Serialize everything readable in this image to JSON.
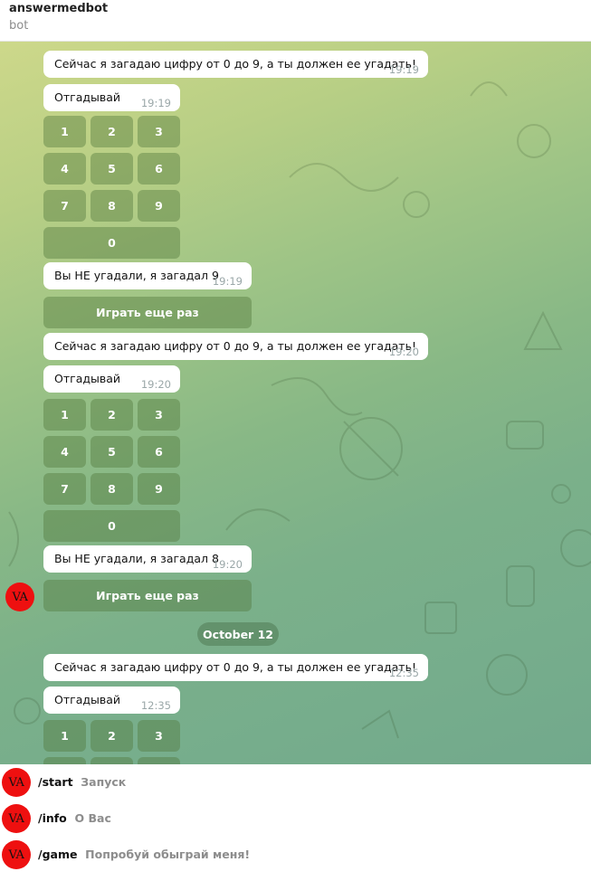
{
  "header": {
    "title": "answermedbot",
    "subtitle": "bot"
  },
  "messages": {
    "prompt": "Сейчас я загадаю цифру от 0 до 9, а ты должен ее угадать!",
    "guess": "Отгадывай",
    "lost9": "Вы НЕ угадали, я загадал 9",
    "lost8": "Вы НЕ угадали, я загадал 8",
    "t1": "19:19",
    "t2": "19:20",
    "t3": "12:35"
  },
  "keyboard": {
    "k1": "1",
    "k2": "2",
    "k3": "3",
    "k4": "4",
    "k5": "5",
    "k6": "6",
    "k7": "7",
    "k8": "8",
    "k9": "9",
    "k0": "0",
    "again": "Играть еще раз"
  },
  "date_separator": "October 12",
  "avatar_initials": "VA",
  "commands": [
    {
      "name": "/start",
      "desc": "Запуск"
    },
    {
      "name": "/info",
      "desc": "О Вас"
    },
    {
      "name": "/game",
      "desc": "Попробуй обыграй меня!"
    }
  ],
  "colors": {
    "accent_avatar": "#ee1010",
    "keyboard_button": "#5a8a48",
    "chat_bg_top": "#cdd88a",
    "chat_bg_bottom": "#72a98c"
  }
}
